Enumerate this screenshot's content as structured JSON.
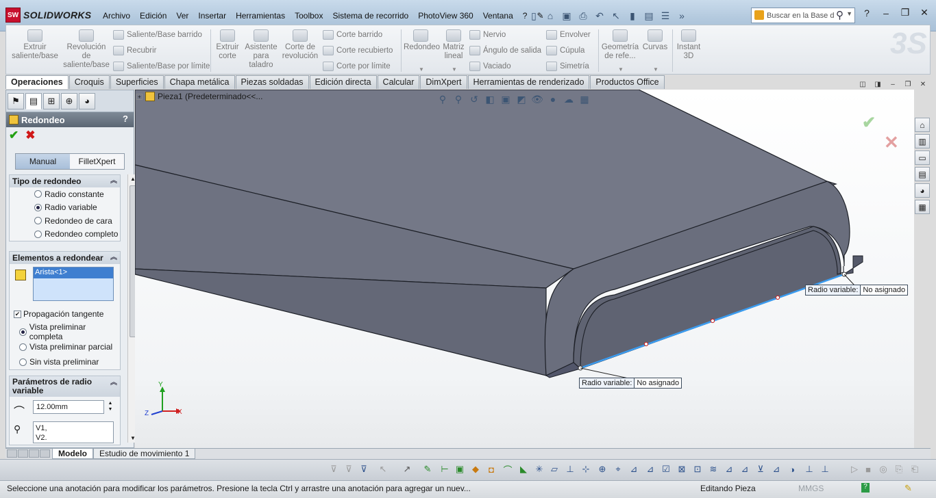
{
  "app": {
    "name": "SOLIDWORKS",
    "logo_text": "SW"
  },
  "menu": [
    "Archivo",
    "Edición",
    "Ver",
    "Insertar",
    "Herramientas",
    "Toolbox",
    "Sistema de recorrido",
    "PhotoView 360",
    "Ventana",
    "?"
  ],
  "search": {
    "placeholder": "Buscar en la Base d"
  },
  "commands": {
    "extruir_saliente": "Extruir saliente/base",
    "revolucion_saliente": "Revolución de saliente/base",
    "saliente_barrido": "Saliente/Base barrido",
    "recubrir": "Recubrir",
    "saliente_limite": "Saliente/Base por límite",
    "extruir_corte": "Extruir corte",
    "asistente_taladro": "Asistente para taladro",
    "corte_revolucion": "Corte de revolución",
    "corte_barrido": "Corte barrido",
    "corte_recubierto": "Corte recubierto",
    "corte_limite": "Corte por límite",
    "redondeo": "Redondeo",
    "matriz_lineal": "Matriz lineal",
    "nervio": "Nervio",
    "angulo_salida": "Ángulo de salida",
    "vaciado": "Vaciado",
    "envolver": "Envolver",
    "cupula": "Cúpula",
    "simetria": "Simetría",
    "geometria_ref": "Geometría de refe...",
    "curvas": "Curvas",
    "instant3d": "Instant 3D"
  },
  "tabs": [
    "Operaciones",
    "Croquis",
    "Superficies",
    "Chapa metálica",
    "Piezas soldadas",
    "Edición directa",
    "Calcular",
    "DimXpert",
    "Herramientas de renderizado",
    "Productos Office"
  ],
  "tree": {
    "root": "Pieza1 (Predeterminado<<..."
  },
  "property_manager": {
    "title": "Redondeo",
    "help": "?",
    "mode_tabs": [
      "Manual",
      "FilletXpert"
    ],
    "fillet_type": {
      "header": "Tipo de redondeo",
      "options": [
        "Radio constante",
        "Radio variable",
        "Redondeo de cara",
        "Redondeo completo"
      ],
      "selected": "Radio variable"
    },
    "items": {
      "header": "Elementos a redondear",
      "selection": "Arista<1>",
      "tangent_propagation": "Propagación tangente",
      "preview_options": [
        "Vista preliminar completa",
        "Vista preliminar parcial",
        "Sin vista preliminar"
      ],
      "preview_selected": "Vista preliminar completa"
    },
    "variable_params": {
      "header": "Parámetros de radio variable",
      "radius_value": "12.00mm",
      "vertices": [
        "V1,",
        "V2."
      ]
    }
  },
  "callouts": {
    "label": "Radio variable:",
    "value": "No asignado"
  },
  "triad": {
    "x": "X",
    "y": "Y",
    "z": "Z"
  },
  "bottom_tabs": [
    "Modelo",
    "Estudio de movimiento 1"
  ],
  "status": {
    "message": "Seleccione una anotación para modificar los parámetros. Presione la tecla Ctrl y arrastre una anotación para agregar un nuev...",
    "mode": "Editando Pieza",
    "units": "MMGS",
    "help_badge": "?"
  },
  "colors": {
    "model": "#6c7080",
    "model_top": "#757988",
    "edge_highlight": "#3b9cf0",
    "ok": "#22a012",
    "cancel": "#d01818"
  }
}
